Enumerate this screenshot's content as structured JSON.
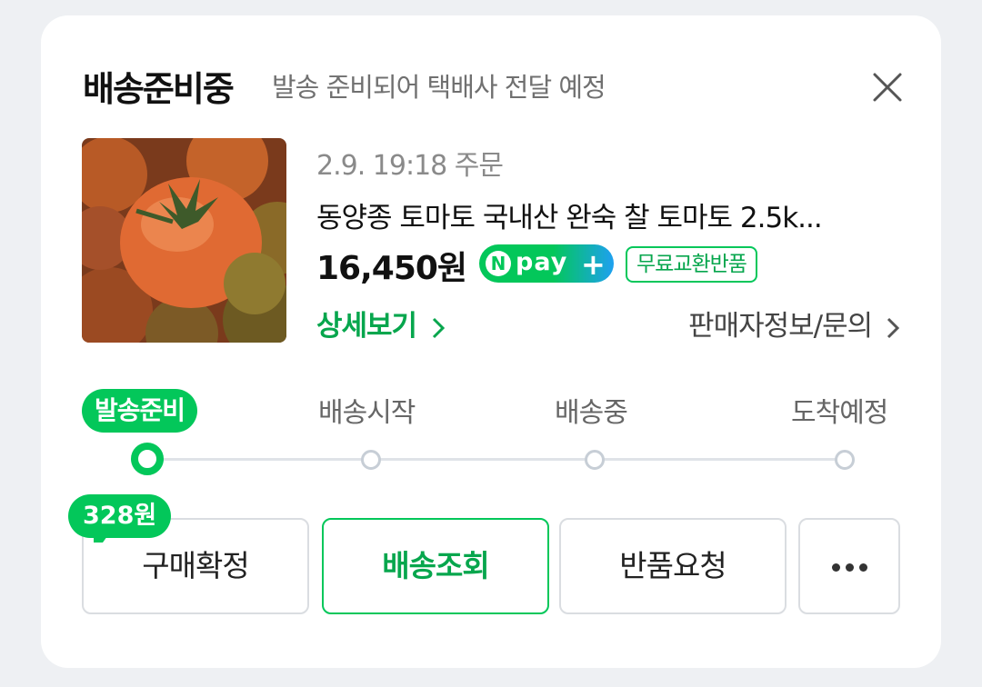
{
  "header": {
    "status": "배송준비중",
    "description": "발송 준비되어 택배사 전달 예정"
  },
  "order": {
    "date": "2.9. 19:18 주문",
    "product_name": "동양종 토마토 국내산 완숙 찰 토마토 2.5k...",
    "price": "16,450원",
    "npay_text": "pay",
    "free_return_label": "무료교환반품",
    "detail_link": "상세보기",
    "seller_link": "판매자정보/문의"
  },
  "progress": {
    "current_step": 0,
    "steps": [
      "발송준비",
      "배송시작",
      "배송중",
      "도착예정"
    ]
  },
  "actions": {
    "reward": "328원",
    "confirm": "구매확정",
    "tracking": "배송조회",
    "return": "반품요청"
  },
  "icons": {
    "close": "close-icon",
    "chevron": "chevron-right-icon",
    "more": "more-icon"
  },
  "colors": {
    "accent": "#03c75a",
    "accent_text": "#07a64d",
    "npay_blue": "#1ea0f0"
  }
}
